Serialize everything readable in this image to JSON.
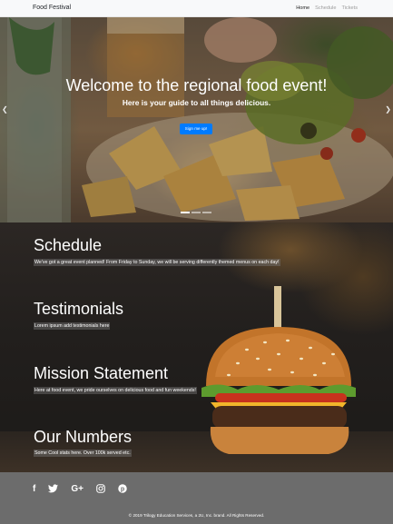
{
  "navbar": {
    "brand": "Food Festival",
    "links": [
      {
        "label": "Home",
        "active": true
      },
      {
        "label": "Schedule",
        "active": false
      },
      {
        "label": "Tickets",
        "active": false
      }
    ]
  },
  "hero": {
    "title": "Welcome to the regional food event!",
    "subtitle": "Here is your guide to all things delicious.",
    "button_label": "Sign me up!",
    "prev_icon": "chevron-left-icon",
    "next_icon": "chevron-right-icon",
    "slides": 3,
    "active_slide": 1
  },
  "sections": [
    {
      "title": "Schedule",
      "text": "We've got a great event planned! From Friday to Sunday, we will be serving differently themed menus on each day!"
    },
    {
      "title": "Testimonials",
      "text": "Lorem ipsum add testimonials here"
    },
    {
      "title": "Mission Statement",
      "text": "Here at food event, we pride ourselves on delicious food and fun weekends!"
    },
    {
      "title": "Our Numbers",
      "text": "Some Cool stats here. Over 100k served etc."
    }
  ],
  "footer": {
    "socials": [
      {
        "name": "facebook-icon",
        "glyph": "f"
      },
      {
        "name": "twitter-icon",
        "glyph": "t"
      },
      {
        "name": "google-plus-icon",
        "glyph": "G+"
      },
      {
        "name": "instagram-icon",
        "glyph": "ig"
      },
      {
        "name": "pinterest-icon",
        "glyph": "p"
      }
    ],
    "copyright": "© 2019 Trilogy Education Services, a 2U, Inc. brand. All Rights Reserved."
  },
  "colors": {
    "primary_button": "#007bff",
    "footer_bg": "#6c6c6c",
    "navbar_bg": "#f8f9fa"
  }
}
